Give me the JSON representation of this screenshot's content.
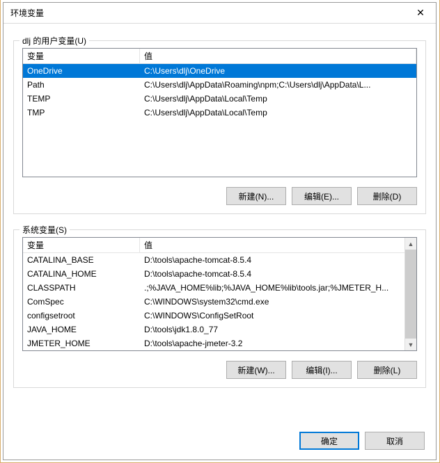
{
  "window": {
    "title": "环境变量",
    "close_glyph": "✕"
  },
  "userSection": {
    "legend": "dlj 的用户变量(U)",
    "columns": {
      "variable": "变量",
      "value": "值"
    },
    "rows": [
      {
        "name": "OneDrive",
        "value": "C:\\Users\\dlj\\OneDrive",
        "selected": true
      },
      {
        "name": "Path",
        "value": "C:\\Users\\dlj\\AppData\\Roaming\\npm;C:\\Users\\dlj\\AppData\\L..."
      },
      {
        "name": "TEMP",
        "value": "C:\\Users\\dlj\\AppData\\Local\\Temp"
      },
      {
        "name": "TMP",
        "value": "C:\\Users\\dlj\\AppData\\Local\\Temp"
      }
    ],
    "buttons": {
      "new": "新建(N)...",
      "edit": "编辑(E)...",
      "delete": "删除(D)"
    }
  },
  "systemSection": {
    "legend": "系统变量(S)",
    "columns": {
      "variable": "变量",
      "value": "值"
    },
    "rows": [
      {
        "name": "CATALINA_BASE",
        "value": "D:\\tools\\apache-tomcat-8.5.4"
      },
      {
        "name": "CATALINA_HOME",
        "value": "D:\\tools\\apache-tomcat-8.5.4"
      },
      {
        "name": "CLASSPATH",
        "value": ".;%JAVA_HOME%lib;%JAVA_HOME%lib\\tools.jar;%JMETER_H..."
      },
      {
        "name": "ComSpec",
        "value": "C:\\WINDOWS\\system32\\cmd.exe"
      },
      {
        "name": "configsetroot",
        "value": "C:\\WINDOWS\\ConfigSetRoot"
      },
      {
        "name": "JAVA_HOME",
        "value": "D:\\tools\\jdk1.8.0_77"
      },
      {
        "name": "JMETER_HOME",
        "value": "D:\\tools\\apache-jmeter-3.2"
      }
    ],
    "buttons": {
      "new": "新建(W)...",
      "edit": "编辑(I)...",
      "delete": "删除(L)"
    }
  },
  "dialogButtons": {
    "ok": "确定",
    "cancel": "取消"
  }
}
